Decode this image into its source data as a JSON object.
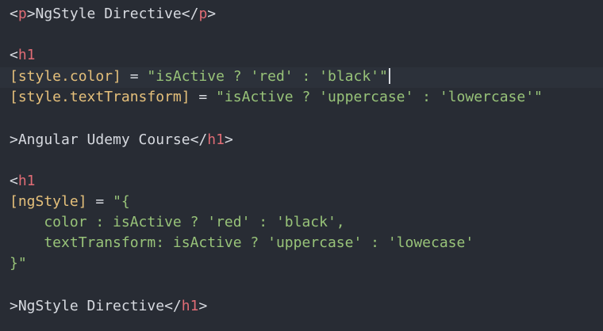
{
  "editor": {
    "active_line": 4,
    "lines": [
      {
        "tokens": [
          {
            "t": "<",
            "k": "punct"
          },
          {
            "t": "p",
            "k": "tag"
          },
          {
            "t": ">NgStyle Directive</",
            "k": "punct"
          },
          {
            "t": "p",
            "k": "tag"
          },
          {
            "t": ">",
            "k": "punct"
          }
        ]
      },
      {
        "tokens": []
      },
      {
        "tokens": [
          {
            "t": "<",
            "k": "punct"
          },
          {
            "t": "h1",
            "k": "tag"
          }
        ]
      },
      {
        "tokens": [
          {
            "t": "[style.color]",
            "k": "attr"
          },
          {
            "t": " = ",
            "k": "punct"
          },
          {
            "t": "\"isActive ? 'red' : 'black'\"",
            "k": "str"
          }
        ],
        "caret": true
      },
      {
        "tokens": [
          {
            "t": "[style.textTransform]",
            "k": "attr"
          },
          {
            "t": " = ",
            "k": "punct"
          },
          {
            "t": "\"isActive ? 'uppercase' : 'lowercase'\"",
            "k": "str"
          }
        ]
      },
      {
        "tokens": []
      },
      {
        "tokens": [
          {
            "t": ">Angular Udemy Course</",
            "k": "punct"
          },
          {
            "t": "h1",
            "k": "tag"
          },
          {
            "t": ">",
            "k": "punct"
          }
        ]
      },
      {
        "tokens": []
      },
      {
        "tokens": [
          {
            "t": "<",
            "k": "punct"
          },
          {
            "t": "h1",
            "k": "tag"
          }
        ]
      },
      {
        "tokens": [
          {
            "t": "[ngStyle]",
            "k": "attr"
          },
          {
            "t": " = ",
            "k": "punct"
          },
          {
            "t": "\"{",
            "k": "str"
          }
        ]
      },
      {
        "tokens": [
          {
            "t": "    color : isActive ? 'red' : 'black',",
            "k": "str"
          }
        ]
      },
      {
        "tokens": [
          {
            "t": "    textTransform: isActive ? 'uppercase' : 'lowecase'",
            "k": "str"
          }
        ]
      },
      {
        "tokens": [
          {
            "t": "}\"",
            "k": "str"
          }
        ]
      },
      {
        "tokens": []
      },
      {
        "tokens": [
          {
            "t": ">NgStyle Directive</",
            "k": "punct"
          },
          {
            "t": "h1",
            "k": "tag"
          },
          {
            "t": ">",
            "k": "punct"
          }
        ]
      }
    ]
  },
  "colors": {
    "background": "#282c34",
    "active_line": "#2c313a",
    "tag": "#e06c75",
    "attribute": "#e5c07b",
    "string": "#98c379",
    "text": "#d7dae0"
  }
}
